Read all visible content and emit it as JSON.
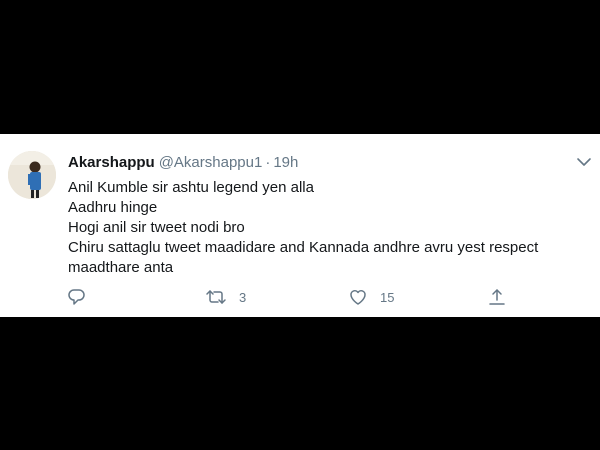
{
  "tweet": {
    "display_name": "Akarshappu",
    "handle": "@Akarshappu1",
    "separator": "·",
    "timestamp": "19h",
    "lines": [
      "Anil Kumble sir ashtu legend yen alla",
      "Aadhru hinge",
      "Hogi anil sir tweet nodi bro",
      "Chiru sattaglu tweet maadidare and Kannada andhre avru yest respect",
      "maadthare anta"
    ],
    "actions": {
      "reply_icon": "reply-icon",
      "retweet_icon": "retweet-icon",
      "retweet_count": "3",
      "like_icon": "like-icon",
      "like_count": "15",
      "share_icon": "share-icon"
    }
  },
  "colors": {
    "background": "#000000",
    "card": "#ffffff",
    "text": "#14171a",
    "muted": "#657786"
  }
}
